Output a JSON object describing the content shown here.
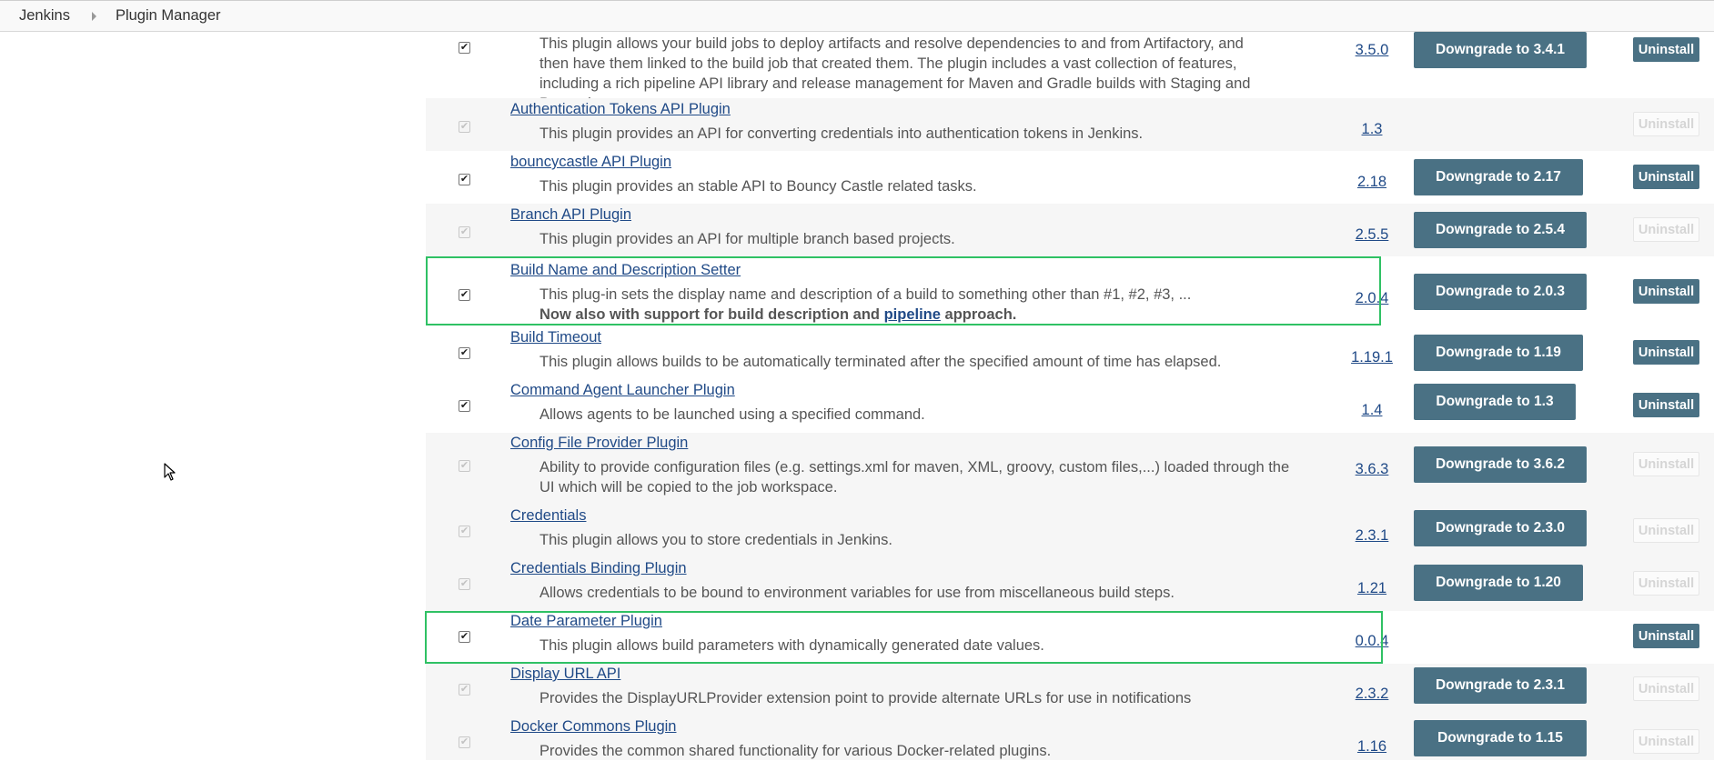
{
  "breadcrumb": {
    "items": [
      "Jenkins",
      "Plugin Manager"
    ]
  },
  "plugins": [
    {
      "name": "",
      "description": "This plugin allows your build jobs to deploy artifacts and resolve dependencies to and from Artifactory, and then have them linked to the build job that created them. The plugin includes a vast collection of features, including a rich pipeline API library and release management for Maven and Gradle builds with Staging and Promotion.",
      "version": "3.5.0",
      "downgrade": "Downgrade to 3.4.1",
      "uninstall": "Uninstall",
      "checked": true,
      "enabled": true,
      "uninstall_enabled": true
    },
    {
      "name": "Authentication Tokens API Plugin",
      "description": "This plugin provides an API for converting credentials into authentication tokens in Jenkins.",
      "version": "1.3",
      "downgrade": "",
      "uninstall": "Uninstall",
      "checked": true,
      "enabled": false,
      "uninstall_enabled": false
    },
    {
      "name": "bouncycastle API Plugin",
      "description": "This plugin provides an stable API to Bouncy Castle related tasks.",
      "version": "2.18",
      "downgrade": "Downgrade to 2.17",
      "uninstall": "Uninstall",
      "checked": true,
      "enabled": true,
      "uninstall_enabled": true
    },
    {
      "name": "Branch API Plugin",
      "description": "This plugin provides an API for multiple branch based projects.",
      "version": "2.5.5",
      "downgrade": "Downgrade to 2.5.4",
      "uninstall": "Uninstall",
      "checked": true,
      "enabled": false,
      "uninstall_enabled": false
    },
    {
      "name": "Build Name and Description Setter",
      "description": "This plug-in sets the display name and description of a build to something other than #1, #2, #3, ...",
      "description_extra_before": "Now also with support for build description and ",
      "description_extra_link": "pipeline",
      "description_extra_after": " approach.",
      "version": "2.0.4",
      "downgrade": "Downgrade to 2.0.3",
      "uninstall": "Uninstall",
      "checked": true,
      "enabled": true,
      "uninstall_enabled": true
    },
    {
      "name": "Build Timeout",
      "description": "This plugin allows builds to be automatically terminated after the specified amount of time has elapsed.",
      "version": "1.19.1",
      "downgrade": "Downgrade to 1.19",
      "uninstall": "Uninstall",
      "checked": true,
      "enabled": true,
      "uninstall_enabled": true
    },
    {
      "name": "Command Agent Launcher Plugin",
      "description": "Allows agents to be launched using a specified command.",
      "version": "1.4",
      "downgrade": "Downgrade to 1.3",
      "uninstall": "Uninstall",
      "checked": true,
      "enabled": true,
      "uninstall_enabled": true
    },
    {
      "name": "Config File Provider Plugin",
      "description": "Ability to provide configuration files (e.g. settings.xml for maven, XML, groovy, custom files,...) loaded through the UI which will be copied to the job workspace.",
      "version": "3.6.3",
      "downgrade": "Downgrade to 3.6.2",
      "uninstall": "Uninstall",
      "checked": true,
      "enabled": false,
      "uninstall_enabled": false
    },
    {
      "name": "Credentials",
      "description": "This plugin allows you to store credentials in Jenkins.",
      "version": "2.3.1",
      "downgrade": "Downgrade to 2.3.0",
      "uninstall": "Uninstall",
      "checked": true,
      "enabled": false,
      "uninstall_enabled": false
    },
    {
      "name": "Credentials Binding Plugin",
      "description": "Allows credentials to be bound to environment variables for use from miscellaneous build steps.",
      "version": "1.21",
      "downgrade": "Downgrade to 1.20",
      "uninstall": "Uninstall",
      "checked": true,
      "enabled": false,
      "uninstall_enabled": false
    },
    {
      "name": "Date Parameter Plugin",
      "description": "This plugin allows build parameters with dynamically generated date values.",
      "version": "0.0.4",
      "downgrade": "",
      "uninstall": "Uninstall",
      "checked": true,
      "enabled": true,
      "uninstall_enabled": true
    },
    {
      "name": "Display URL API",
      "description": "Provides the DisplayURLProvider extension point to provide alternate URLs for use in notifications",
      "version": "2.3.2",
      "downgrade": "Downgrade to 2.3.1",
      "uninstall": "Uninstall",
      "checked": true,
      "enabled": false,
      "uninstall_enabled": false
    },
    {
      "name": "Docker Commons Plugin",
      "description": "Provides the common shared functionality for various Docker-related plugins.",
      "version": "1.16",
      "downgrade": "Downgrade to 1.15",
      "uninstall": "Uninstall",
      "checked": true,
      "enabled": false,
      "uninstall_enabled": false
    }
  ],
  "colors": {
    "button": "#4a7184",
    "link": "#204a87",
    "highlight": "#2fc164"
  }
}
